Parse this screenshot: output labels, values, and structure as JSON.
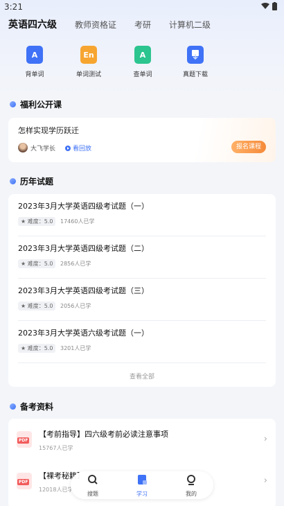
{
  "status_bar": {
    "time": "3:21"
  },
  "top_tabs": [
    {
      "label": "英语四六级",
      "active": true
    },
    {
      "label": "教师资格证",
      "active": false
    },
    {
      "label": "考研",
      "active": false
    },
    {
      "label": "计算机二级",
      "active": false
    }
  ],
  "quick_actions": [
    {
      "label": "背单词",
      "icon": "vocab-book-icon",
      "glyph": "A",
      "color": "#3f72f6"
    },
    {
      "label": "单词测试",
      "icon": "word-test-icon",
      "glyph": "En",
      "color": "#f7a531"
    },
    {
      "label": "查单词",
      "icon": "word-lookup-icon",
      "glyph": "A",
      "color": "#2cc48f"
    },
    {
      "label": "真题下载",
      "icon": "download-icon",
      "glyph": "▮",
      "color": "#3f72f6"
    }
  ],
  "public_course": {
    "section_title": "福利公开课",
    "course_title": "怎样实现学历跃迁",
    "teacher": "大飞学长",
    "replay_label": "看回放",
    "enroll_label": "报名课程"
  },
  "past_exams": {
    "section_title": "历年试题",
    "items": [
      {
        "title": "2023年3月大学英语四级考试题（一）",
        "difficulty": "难度：5.0",
        "learners": "17460人已学"
      },
      {
        "title": "2023年3月大学英语四级考试题（二）",
        "difficulty": "难度：5.0",
        "learners": "2856人已学"
      },
      {
        "title": "2023年3月大学英语四级考试题（三）",
        "difficulty": "难度：5.0",
        "learners": "2056人已学"
      },
      {
        "title": "2023年3月大学英语六级考试题（一）",
        "difficulty": "难度：5.0",
        "learners": "3201人已学"
      }
    ],
    "view_all_label": "查看全部"
  },
  "materials": {
    "section_title": "备考资料",
    "items": [
      {
        "title": "【考前指导】四六级考前必读注意事项",
        "count": "15767人已学"
      },
      {
        "title": "【裸考秘籍】",
        "count": "12018人已学"
      }
    ],
    "pdf_label": "PDF"
  },
  "bottom_nav": [
    {
      "label": "搜题",
      "icon": "search-icon",
      "active": false
    },
    {
      "label": "学习",
      "icon": "study-book-icon",
      "active": true
    },
    {
      "label": "我的",
      "icon": "profile-icon",
      "active": false
    }
  ],
  "colors": {
    "accent": "#3f72f6",
    "enroll": "#f58a3a",
    "background": "#f3f5f9"
  }
}
